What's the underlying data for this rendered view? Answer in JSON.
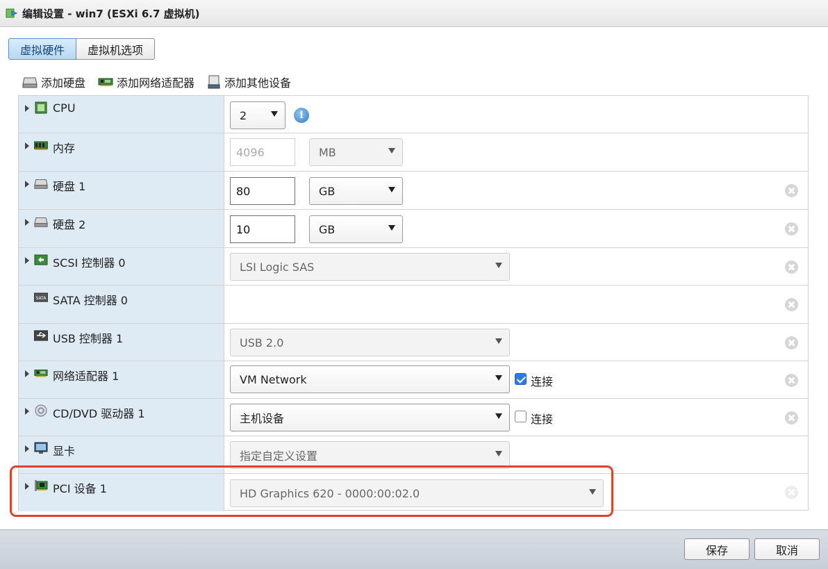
{
  "window": {
    "title": "编辑设置 - win7 (ESXi 6.7 虚拟机)"
  },
  "tabs": [
    {
      "label": "虚拟硬件",
      "active": true
    },
    {
      "label": "虚拟机选项",
      "active": false
    }
  ],
  "add_buttons": {
    "disk": "添加硬盘",
    "network": "添加网络适配器",
    "other": "添加其他设备"
  },
  "devices": {
    "cpu": {
      "label": "CPU",
      "value": "2"
    },
    "memory": {
      "label": "内存",
      "placeholder": "4096",
      "unit": "MB"
    },
    "disk1": {
      "label": "硬盘 1",
      "value": "80",
      "unit": "GB"
    },
    "disk2": {
      "label": "硬盘 2",
      "value": "10",
      "unit": "GB"
    },
    "scsi": {
      "label": "SCSI 控制器 0",
      "value": "LSI Logic SAS"
    },
    "sata": {
      "label": "SATA 控制器 0"
    },
    "usb": {
      "label": "USB 控制器 1",
      "value": "USB 2.0"
    },
    "nic": {
      "label": "网络适配器 1",
      "value": "VM Network",
      "connect_label": "连接",
      "connected": true
    },
    "cdrom": {
      "label": "CD/DVD 驱动器 1",
      "value": "主机设备",
      "connect_label": "连接",
      "connected": false
    },
    "display": {
      "label": "显卡",
      "value": "指定自定义设置"
    },
    "pci": {
      "label": "PCI 设备 1",
      "value": "HD Graphics 620 - 0000:00:02.0"
    }
  },
  "footer": {
    "save_label": "保存",
    "cancel_label": "取消"
  },
  "colors": {
    "label_column": "#deeaf4",
    "active_tab": "#b8d8f3",
    "highlight": "#e0412d",
    "checkbox_on": "#2d7be0"
  }
}
